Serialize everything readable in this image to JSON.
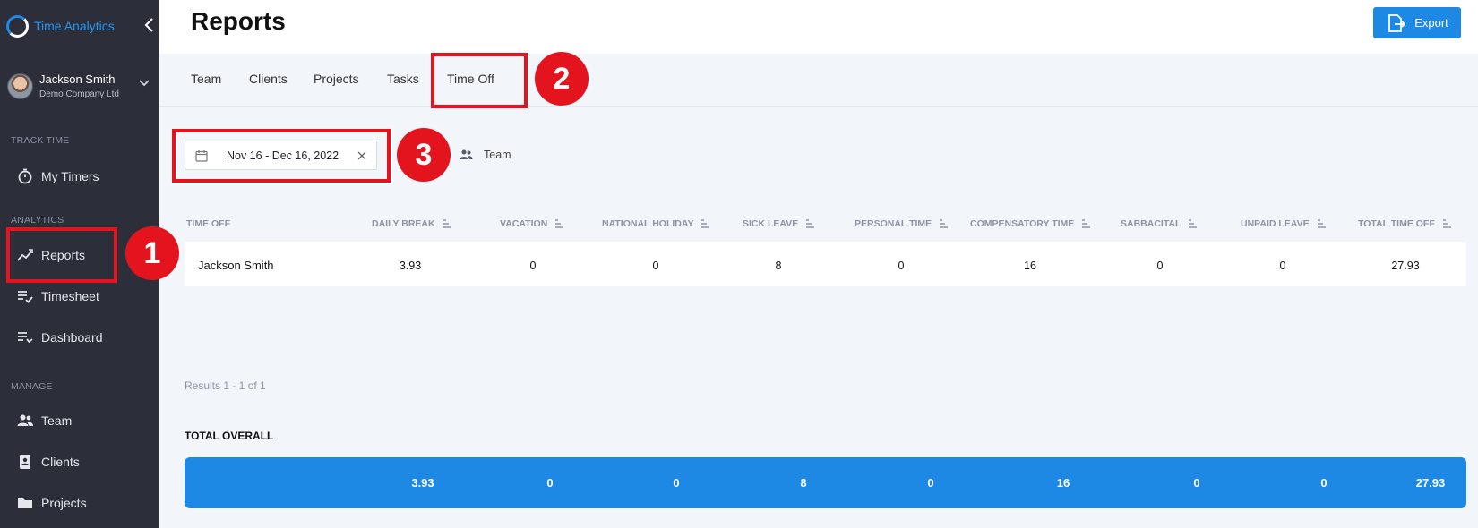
{
  "app": {
    "name": "Time Analytics",
    "accent": "#1e88e5",
    "annotation_color": "#e3141e"
  },
  "user": {
    "name": "Jackson Smith",
    "company": "Demo Company Ltd"
  },
  "sidebar": {
    "sections": {
      "track": "TRACK TIME",
      "analytics": "ANALYTICS",
      "manage": "MANAGE"
    },
    "items": {
      "my_timers": "My Timers",
      "reports": "Reports",
      "timesheet": "Timesheet",
      "dashboard": "Dashboard",
      "team": "Team",
      "clients": "Clients",
      "projects": "Projects"
    }
  },
  "header": {
    "title": "Reports",
    "export_label": "Export"
  },
  "tabs": [
    "Team",
    "Clients",
    "Projects",
    "Tasks",
    "Time Off"
  ],
  "filters": {
    "date_range": "Nov 16 - Dec 16, 2022",
    "team_label": "Team"
  },
  "annotations": [
    "1",
    "2",
    "3"
  ],
  "table": {
    "columns": [
      "TIME OFF",
      "DAILY BREAK",
      "VACATION",
      "NATIONAL HOLIDAY",
      "SICK LEAVE",
      "PERSONAL TIME",
      "COMPENSATORY TIME",
      "SABBACITAL",
      "UNPAID LEAVE",
      "TOTAL TIME OFF"
    ],
    "rows": [
      {
        "name": "Jackson Smith",
        "values": [
          "3.93",
          "0",
          "0",
          "8",
          "0",
          "16",
          "0",
          "0",
          "27.93"
        ]
      }
    ]
  },
  "results_text": "Results 1 - 1 of 1",
  "totals": {
    "label": "TOTAL OVERALL",
    "values": [
      "3.93",
      "0",
      "0",
      "8",
      "0",
      "16",
      "0",
      "0",
      "27.93"
    ]
  }
}
